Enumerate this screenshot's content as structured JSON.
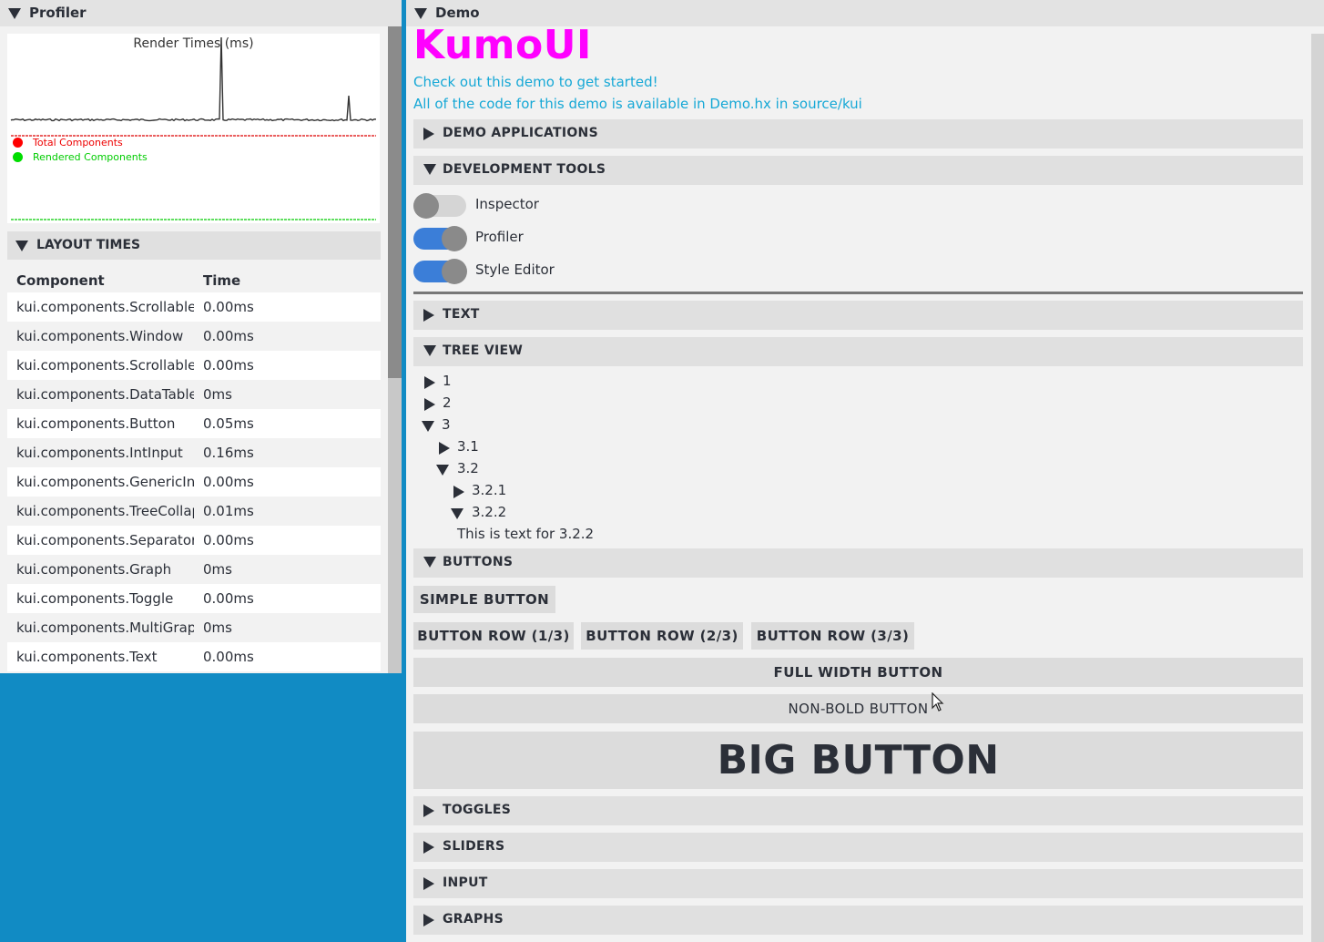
{
  "profiler": {
    "title": "Profiler",
    "graph": {
      "title": "Render Times (ms)",
      "legend": [
        {
          "label": "Total Components",
          "color": "#ff0000"
        },
        {
          "label": "Rendered Components",
          "color": "#00dd00"
        }
      ]
    },
    "layout_times": {
      "title": "LAYOUT TIMES",
      "columns": [
        "Component",
        "Time"
      ],
      "rows": [
        [
          "kui.components.Scrollable",
          "0.00ms"
        ],
        [
          "kui.components.Window",
          "0.00ms"
        ],
        [
          "kui.components.Scrollable",
          "0.00ms"
        ],
        [
          "kui.components.DataTable",
          "0ms"
        ],
        [
          "kui.components.Button",
          "0.05ms"
        ],
        [
          "kui.components.IntInput",
          "0.16ms"
        ],
        [
          "kui.components.GenericInput",
          "0.00ms"
        ],
        [
          "kui.components.TreeCollapse",
          "0.01ms"
        ],
        [
          "kui.components.Separator",
          "0.00ms"
        ],
        [
          "kui.components.Graph",
          "0ms"
        ],
        [
          "kui.components.Toggle",
          "0.00ms"
        ],
        [
          "kui.components.MultiGraph",
          "0ms"
        ],
        [
          "kui.components.Text",
          "0.00ms"
        ]
      ]
    }
  },
  "demo": {
    "title": "Demo",
    "logo": "KumoUI",
    "intro_1": "Check out this demo to get started!",
    "intro_2": "All of the code for this demo is available in Demo.hx in source/kui",
    "sections": {
      "demo_apps": "DEMO APPLICATIONS",
      "dev_tools": "DEVELOPMENT TOOLS",
      "text": "TEXT",
      "tree_view": "TREE VIEW",
      "buttons": "BUTTONS",
      "toggles": "TOGGLES",
      "sliders": "SLIDERS",
      "input": "INPUT",
      "graphs": "GRAPHS"
    },
    "toggles": {
      "inspector": {
        "label": "Inspector",
        "on": false
      },
      "profiler": {
        "label": "Profiler",
        "on": true
      },
      "style_editor": {
        "label": "Style Editor",
        "on": true
      }
    },
    "tree": {
      "n1": "1",
      "n2": "2",
      "n3": "3",
      "n31": "3.1",
      "n32": "3.2",
      "n321": "3.2.1",
      "n322": "3.2.2",
      "leaf_text": "This is text for 3.2.2"
    },
    "buttons": {
      "simple": "SIMPLE BUTTON",
      "row1": "BUTTON ROW (1/3)",
      "row2": "BUTTON ROW (2/3)",
      "row3": "BUTTON ROW (3/3)",
      "full": "FULL WIDTH BUTTON",
      "nonbold": "NON-BOLD BUTTON",
      "big": "BIG BUTTON"
    }
  },
  "colors": {
    "background": "#118bc4",
    "logo": "#ff00ff",
    "link": "#16a8d6",
    "toggle_on": "#3b7ed8"
  }
}
